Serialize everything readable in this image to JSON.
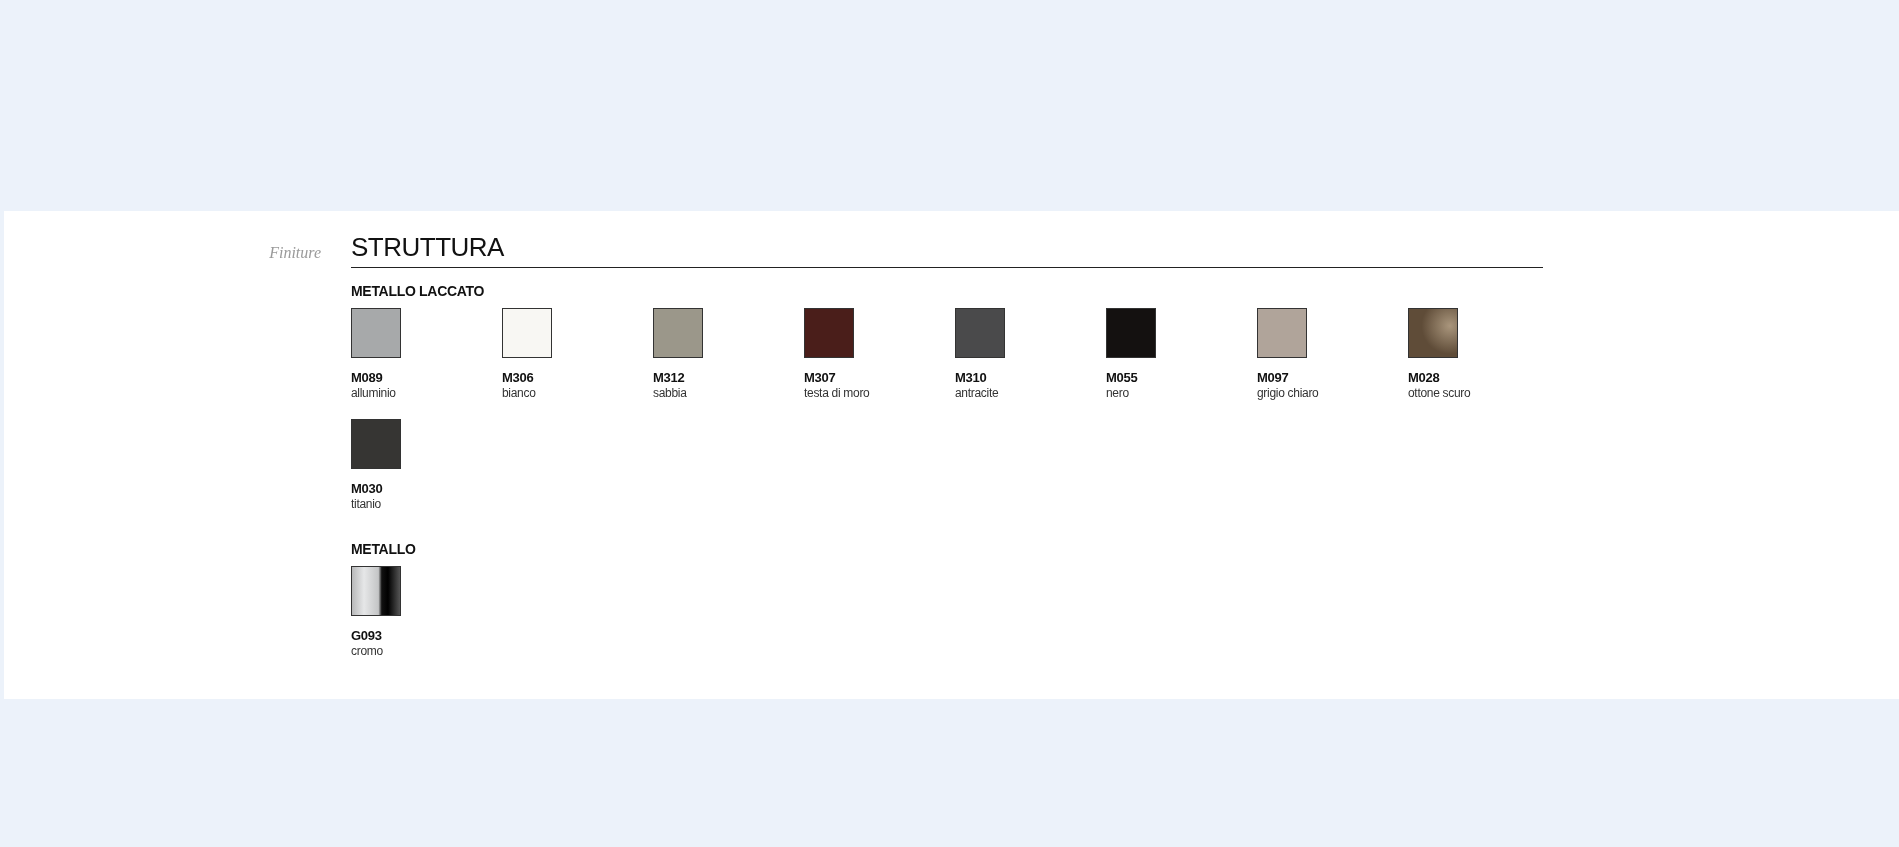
{
  "side_label": "Finiture",
  "title": "STRUTTURA",
  "groups": [
    {
      "heading": "METALLO LACCATO",
      "swatches": [
        {
          "code": "M089",
          "name": "alluminio",
          "kind": "flat",
          "color": "#a7a9aa"
        },
        {
          "code": "M306",
          "name": "bianco",
          "kind": "flat",
          "color": "#f8f7f3"
        },
        {
          "code": "M312",
          "name": "sabbia",
          "kind": "flat",
          "color": "#9b978a"
        },
        {
          "code": "M307",
          "name": "testa di moro",
          "kind": "flat",
          "color": "#4a1e1a"
        },
        {
          "code": "M310",
          "name": "antracite",
          "kind": "flat",
          "color": "#4a4a4b"
        },
        {
          "code": "M055",
          "name": "nero",
          "kind": "flat",
          "color": "#141110"
        },
        {
          "code": "M097",
          "name": "grigio chiaro",
          "kind": "flat",
          "color": "#b0a49a"
        },
        {
          "code": "M028",
          "name": "ottone scuro",
          "kind": "metallic",
          "color": "#5f4c38"
        },
        {
          "code": "M030",
          "name": "titanio",
          "kind": "flat",
          "color": "#363533"
        }
      ]
    },
    {
      "heading": "METALLO",
      "swatches": [
        {
          "code": "G093",
          "name": "cromo",
          "kind": "chrome"
        }
      ]
    }
  ]
}
